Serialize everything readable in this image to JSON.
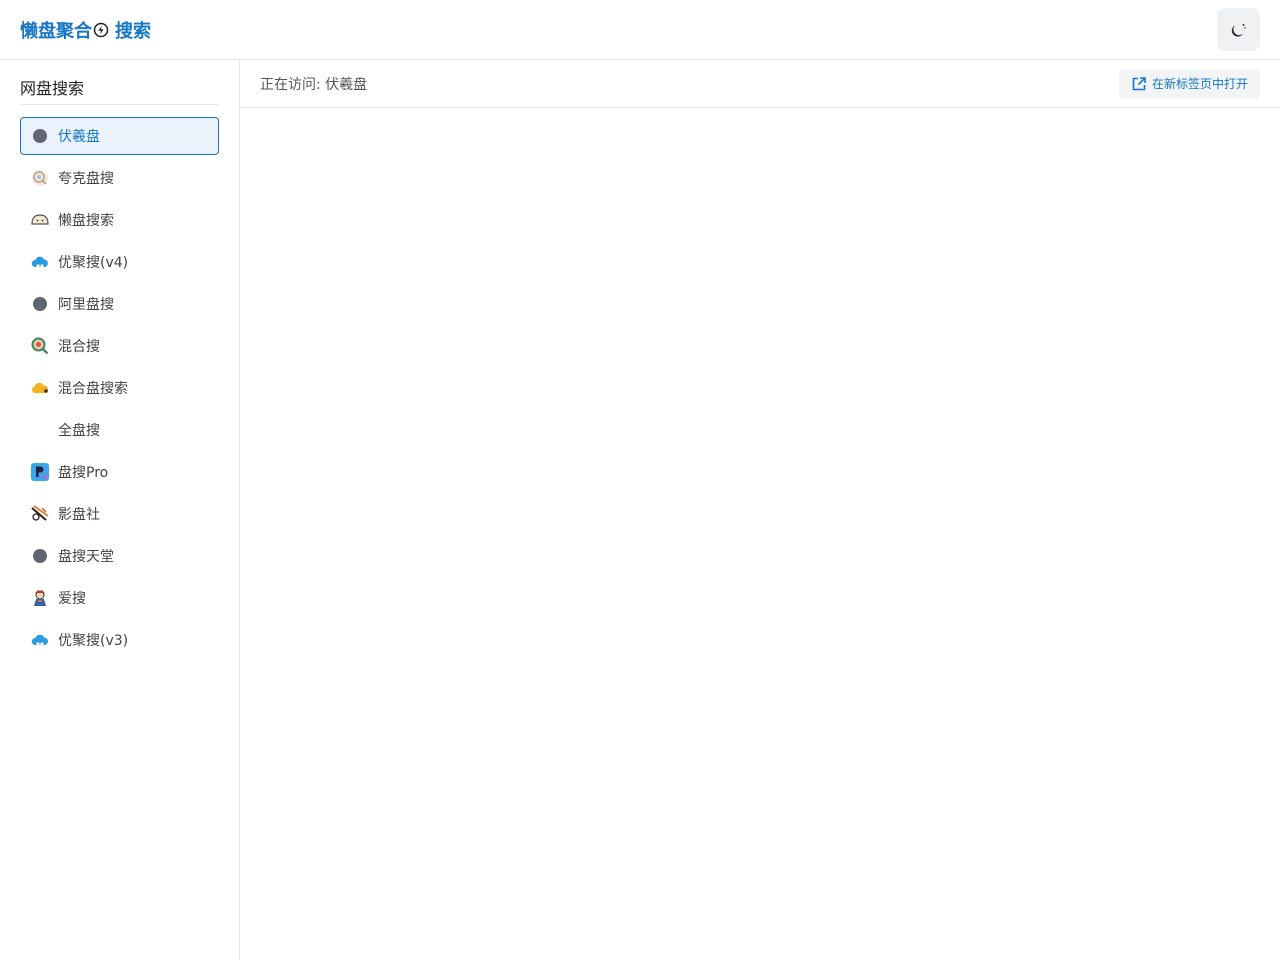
{
  "header": {
    "logo_text_1": "懒盘聚合",
    "logo_text_2": "搜索",
    "theme_icon": "moon-icon"
  },
  "sidebar": {
    "title": "网盘搜索",
    "items": [
      {
        "label": "伏羲盘",
        "icon": "dot-icon",
        "active": true
      },
      {
        "label": "夸克盘搜",
        "icon": "quark-icon"
      },
      {
        "label": "懒盘搜索",
        "icon": "bun-icon"
      },
      {
        "label": "优聚搜(v4)",
        "icon": "cloud-icon"
      },
      {
        "label": "阿里盘搜",
        "icon": "dot-icon"
      },
      {
        "label": "混合搜",
        "icon": "magnifier-icon"
      },
      {
        "label": "混合盘搜索",
        "icon": "orange-cloud-icon"
      },
      {
        "label": "全盘搜",
        "icon": "none"
      },
      {
        "label": "盘搜Pro",
        "icon": "p-badge-icon"
      },
      {
        "label": "影盘社",
        "icon": "film-icon"
      },
      {
        "label": "盘搜天堂",
        "icon": "dot-icon"
      },
      {
        "label": "爱搜",
        "icon": "character-icon"
      },
      {
        "label": "优聚搜(v3)",
        "icon": "cloud-icon"
      }
    ]
  },
  "main": {
    "visiting_text": "正在访问: 伏羲盘",
    "open_new_tab_label": "在新标签页中打开"
  },
  "colors": {
    "accent": "#1677c9",
    "active_bg": "#eaf3fc",
    "dot": "#5f6570"
  }
}
